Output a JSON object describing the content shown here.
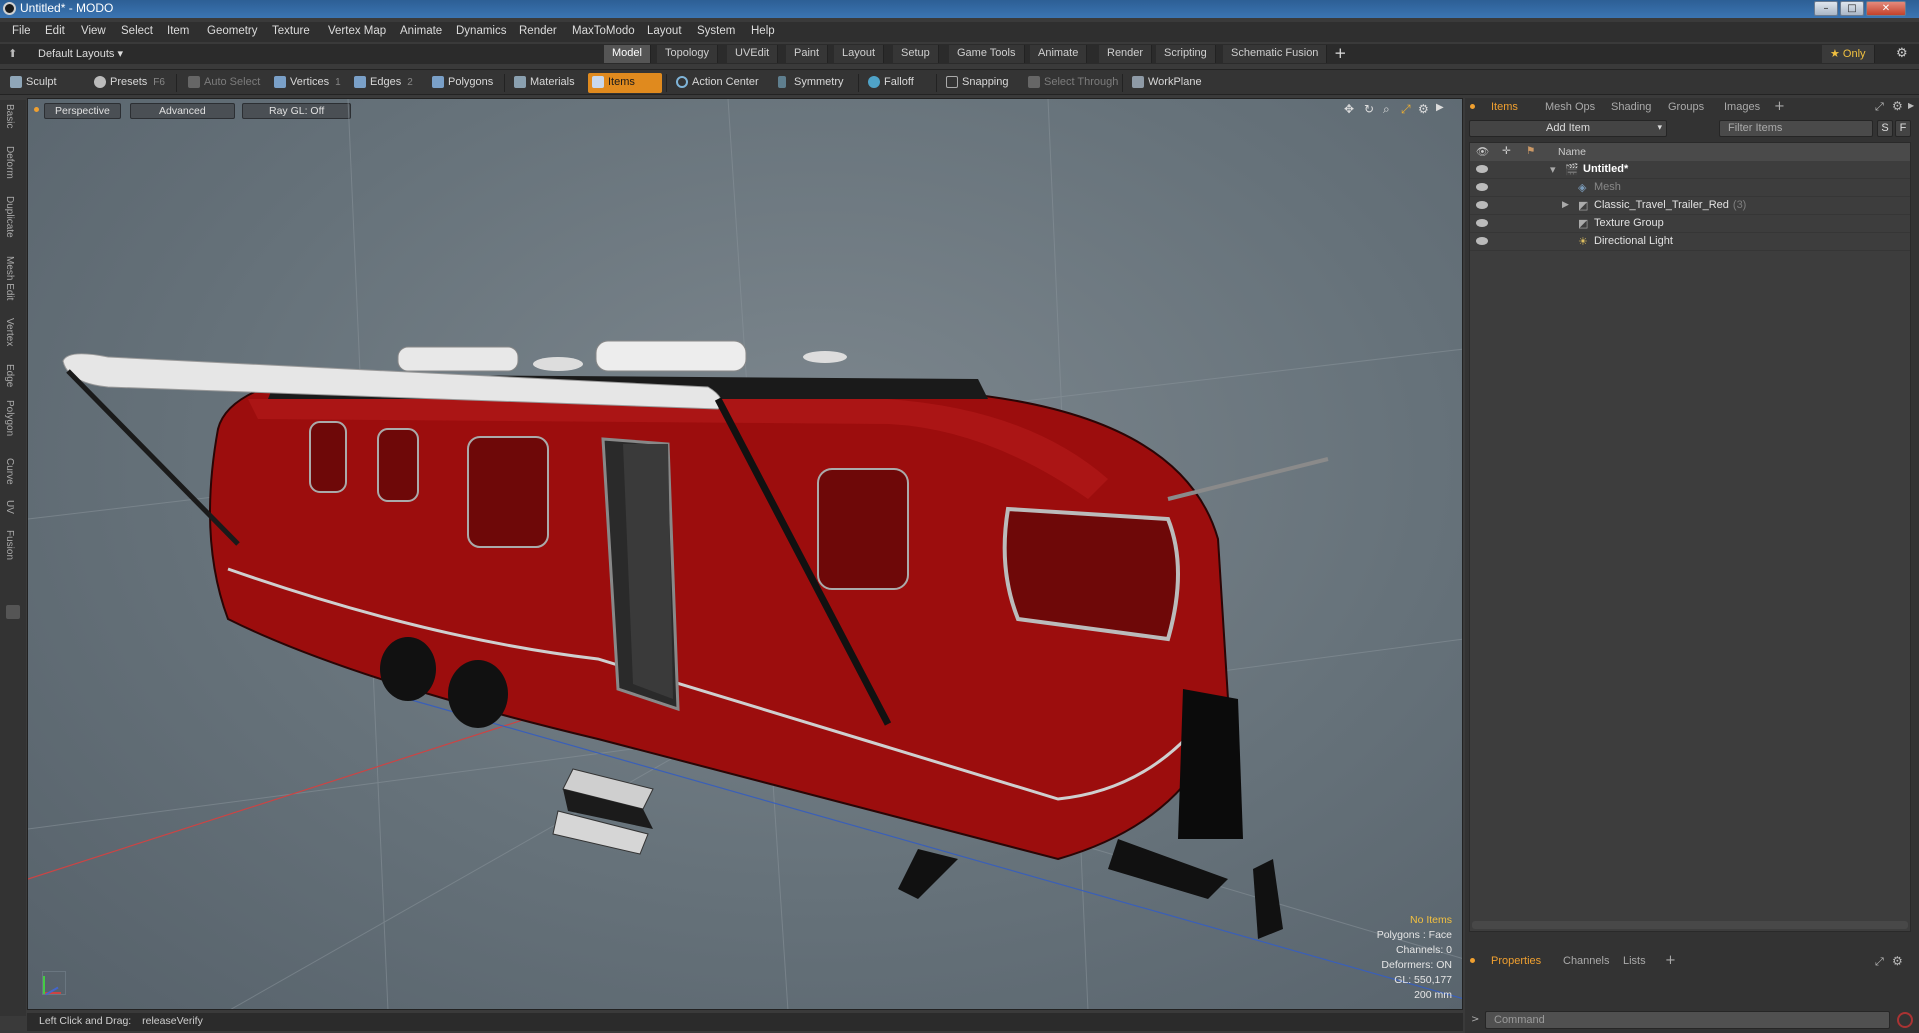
{
  "window": {
    "title": "Untitled* - MODO",
    "min": "–",
    "max": "□",
    "close": "✕"
  },
  "menu": [
    "File",
    "Edit",
    "View",
    "Select",
    "Item",
    "Geometry",
    "Texture",
    "Vertex Map",
    "Animate",
    "Dynamics",
    "Render",
    "MaxToModo",
    "Layout",
    "System",
    "Help"
  ],
  "layout_bar": {
    "default_layouts": "Default Layouts ▾",
    "tabs": [
      "Model",
      "Topology",
      "UVEdit",
      "Paint",
      "Layout",
      "Setup",
      "Game Tools",
      "Animate",
      "Render",
      "Scripting",
      "Schematic Fusion"
    ],
    "active_tab": "Model",
    "add": "+",
    "only": "★ Only"
  },
  "toolbar": {
    "sculpt": "Sculpt",
    "presets": "Presets",
    "presets_key": "F6",
    "auto_select": "Auto Select",
    "vertices": "Vertices",
    "vertices_key": "1",
    "edges": "Edges",
    "edges_key": "2",
    "polygons": "Polygons",
    "materials": "Materials",
    "items": "Items",
    "action_center": "Action Center",
    "symmetry": "Symmetry",
    "falloff": "Falloff",
    "snapping": "Snapping",
    "select_through": "Select Through",
    "workplane": "WorkPlane"
  },
  "left_tabs": [
    "Basic",
    "Deform",
    "Duplicate",
    "Mesh Edit",
    "Vertex",
    "Edge",
    "Polygon",
    "Curve",
    "UV",
    "Fusion"
  ],
  "viewport": {
    "perspective": "Perspective",
    "advanced": "Advanced",
    "raygl": "Ray GL: Off",
    "info": {
      "no_items": "No Items",
      "polygons": "Polygons : Face",
      "channels": "Channels: 0",
      "deformers": "Deformers: ON",
      "gl": "GL: 550,177",
      "scale": "200 mm"
    }
  },
  "status": {
    "hint": "Left Click and Drag:",
    "action": "releaseVerify"
  },
  "panel": {
    "tabs": [
      "Items",
      "Mesh Ops",
      "Shading",
      "Groups",
      "Images"
    ],
    "active_tab": "Items",
    "add_item": "Add Item",
    "filter_placeholder": "Filter Items",
    "s_btn": "S",
    "f_btn": "F",
    "col_name": "Name",
    "tree": [
      {
        "label": "Untitled*",
        "count": ""
      },
      {
        "label": "Mesh",
        "count": ""
      },
      {
        "label": "Classic_Travel_Trailer_Red",
        "count": "(3)"
      },
      {
        "label": "Texture Group",
        "count": ""
      },
      {
        "label": "Directional Light",
        "count": ""
      }
    ],
    "bottom_tabs": [
      "Properties",
      "Channels",
      "Lists"
    ],
    "bottom_active": "Properties",
    "command_placeholder": "Command"
  },
  "colors": {
    "accent": "#e08a1e",
    "trailer_red": "#9c0d0d",
    "titlebar": "#3b75b3"
  }
}
